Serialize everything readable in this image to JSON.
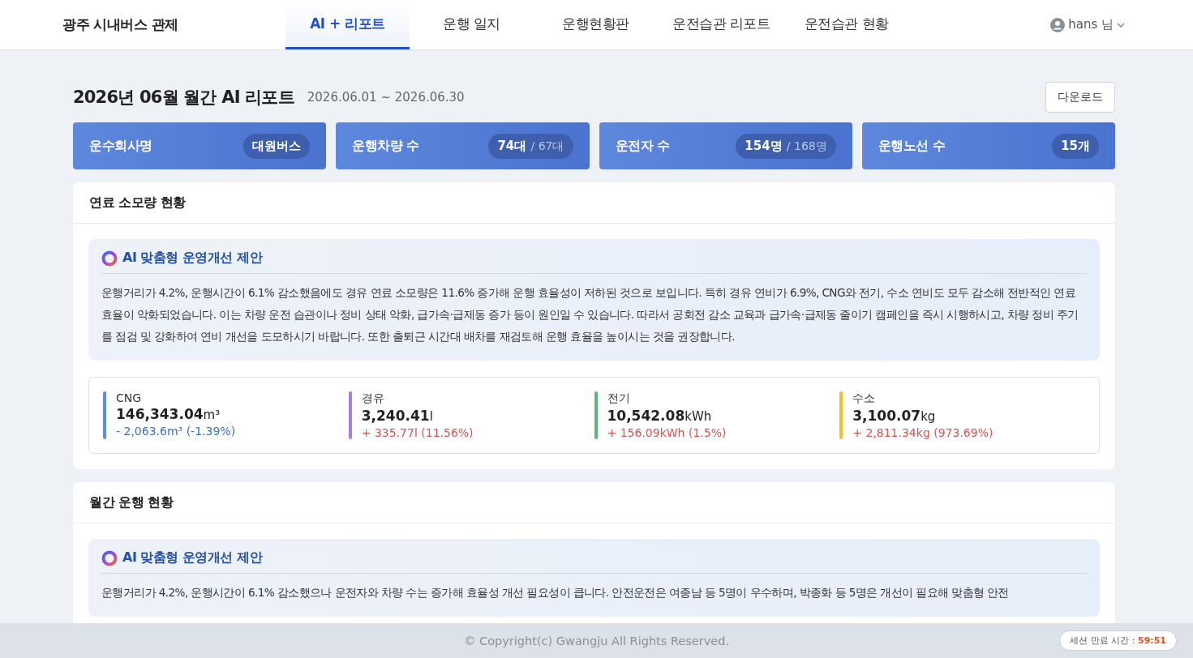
{
  "header": {
    "brand": "광주 시내버스 관제",
    "nav": [
      {
        "label": "AI + 리포트",
        "selected": true
      },
      {
        "label": "운행 일지",
        "selected": false
      },
      {
        "label": "운행현황판",
        "selected": false
      },
      {
        "label": "운전습관 리포트",
        "selected": false
      },
      {
        "label": "운전습관 현황",
        "selected": false
      }
    ],
    "user": "hans 님"
  },
  "report": {
    "title": "2026년 06월 월간 AI 리포트",
    "period": "2026.06.01 ~ 2026.06.30",
    "download": "다운로드"
  },
  "summary": [
    {
      "label": "운수회사명",
      "value": "대원버스"
    },
    {
      "label": "운행차량 수",
      "value": "74대",
      "sub": "/ 67대"
    },
    {
      "label": "운전자 수",
      "value": "154명",
      "sub": "/ 168명"
    },
    {
      "label": "운행노선 수",
      "value": "15개"
    }
  ],
  "sections": [
    {
      "title": "연료 소모량 현황",
      "ai": {
        "title": "AI 맞춤형 운영개선 제안",
        "text": "운행거리가 4.2%, 운행시간이 6.1% 감소했음에도 경유 연료 소모량은 11.6% 증가해 운행 효율성이 저하된 것으로 보입니다. 특히 경유 연비가 6.9%, CNG와 전기, 수소 연비도 모두 감소해 전반적인 연료 효율이 악화되었습니다. 이는 차량 운전 습관이나 정비 상태 악화, 급가속·급제동 증가 등이 원인일 수 있습니다. 따라서 공회전 감소 교육과 급가속·급제동 줄이기 캠페인을 즉시 시행하시고, 차량 정비 주기를 점검 및 강화하여 연비 개선을 도모하시기 바랍니다. 또한 출퇴근 시간대 배차를 재검토해 운행 효율을 높이시는 것을 권장합니다."
      },
      "fuels": [
        {
          "name": "CNG",
          "value": "146,343.04",
          "unit": "m³",
          "change": "- 2,063.6m³ (-1.39%)",
          "increased": false,
          "color": "#5b8ddf"
        },
        {
          "name": "경유",
          "value": "3,240.41",
          "unit": "l",
          "change": "+ 335.77l (11.56%)",
          "increased": true,
          "color": "#a77fd6"
        },
        {
          "name": "전기",
          "value": "10,542.08",
          "unit": "kWh",
          "change": "+ 156.09kWh (1.5%)",
          "increased": true,
          "color": "#5cb57a"
        },
        {
          "name": "수소",
          "value": "3,100.07",
          "unit": "kg",
          "change": "+ 2,811.34kg (973.69%)",
          "increased": true,
          "color": "#f0bf2c"
        }
      ]
    },
    {
      "title": "월간 운행 현황",
      "ai": {
        "title": "AI 맞춤형 운영개선 제안",
        "text": "운행거리가 4.2%, 운행시간이 6.1% 감소했으나 운전자와 차량 수는 증가해 효율성 개선 필요성이 큽니다. 안전운전은 여종남 등 5명이 우수하며, 박종화 등 5명은 개선이 필요해 맞춤형 안전"
      }
    }
  ],
  "footer": {
    "copyright": "© Copyright(c) Gwangju All Rights Reserved.",
    "session_label": "세션 만료 시간 :",
    "session_time": "59:51"
  }
}
